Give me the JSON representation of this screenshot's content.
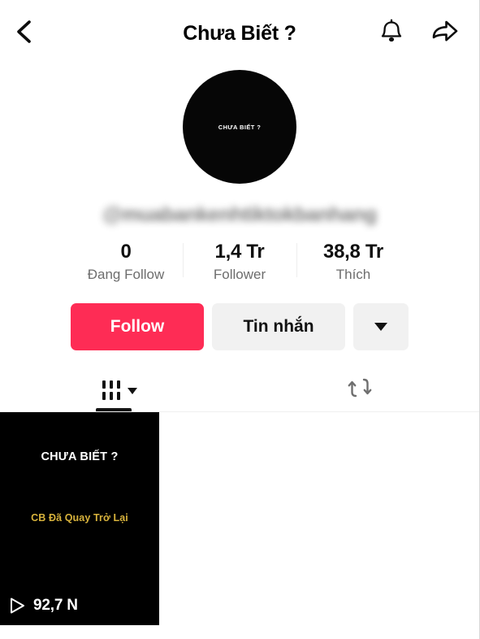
{
  "header": {
    "title": "Chưa Biết ?",
    "back_icon": "chevron-left-icon",
    "notification_icon": "bell-icon",
    "share_icon": "share-arrow-icon"
  },
  "profile": {
    "avatar_text": "CHƯA BIẾT ?",
    "username": "@muabankenhtiktokbanhang",
    "username_blurred": true
  },
  "stats": [
    {
      "value": "0",
      "label": "Đang Follow"
    },
    {
      "value": "1,4 Tr",
      "label": "Follower"
    },
    {
      "value": "38,8 Tr",
      "label": "Thích"
    }
  ],
  "actions": {
    "follow_label": "Follow",
    "message_label": "Tin nhắn",
    "more_icon": "caret-down-icon",
    "follow_color": "#fe2c55",
    "secondary_color": "#f1f1f1"
  },
  "tabs": [
    {
      "name": "videos",
      "icon": "grid-icon",
      "has_caret": true,
      "active": true
    },
    {
      "name": "reposts",
      "icon": "repost-icon",
      "has_caret": false,
      "active": false
    }
  ],
  "videos": [
    {
      "title": "CHƯA BIẾT ?",
      "subtitle": "CB Đã Quay Trở Lại",
      "play_icon": "play-icon",
      "play_count": "92,7 N",
      "subtitle_color": "#d7b23c"
    }
  ]
}
